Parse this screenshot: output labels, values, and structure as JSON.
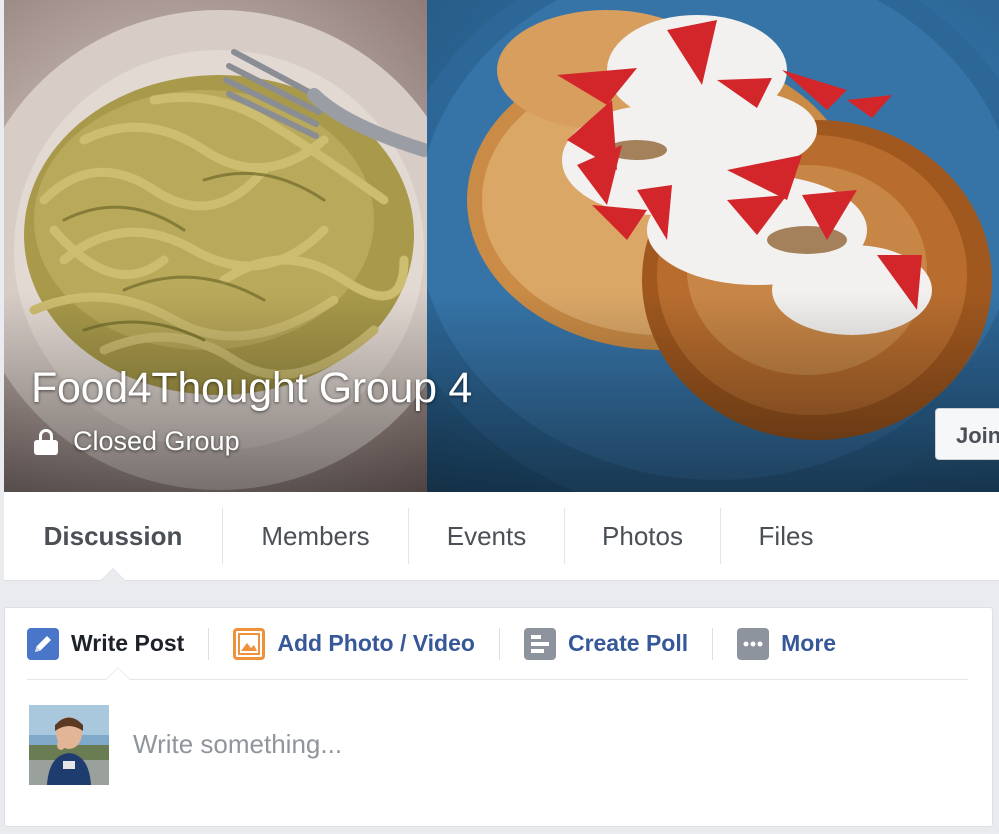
{
  "group": {
    "name": "Food4Thought Group 4",
    "privacy_label": "Closed Group",
    "join_label": "Join Group"
  },
  "tabs": [
    {
      "label": "Discussion",
      "active": true
    },
    {
      "label": "Members",
      "active": false
    },
    {
      "label": "Events",
      "active": false
    },
    {
      "label": "Photos",
      "active": false
    },
    {
      "label": "Files",
      "active": false
    }
  ],
  "composer": {
    "actions": [
      {
        "label": "Write Post",
        "icon": "pencil-icon",
        "active": true
      },
      {
        "label": "Add Photo / Video",
        "icon": "photo-icon",
        "active": false
      },
      {
        "label": "Create Poll",
        "icon": "poll-icon",
        "active": false
      },
      {
        "label": "More",
        "icon": "more-dots-icon",
        "active": false
      }
    ],
    "placeholder": "Write something..."
  },
  "colors": {
    "link_blue": "#365899",
    "pencil_blue": "#4a76c9",
    "photo_orange": "#f0923b",
    "page_bg": "#e9ebee"
  }
}
